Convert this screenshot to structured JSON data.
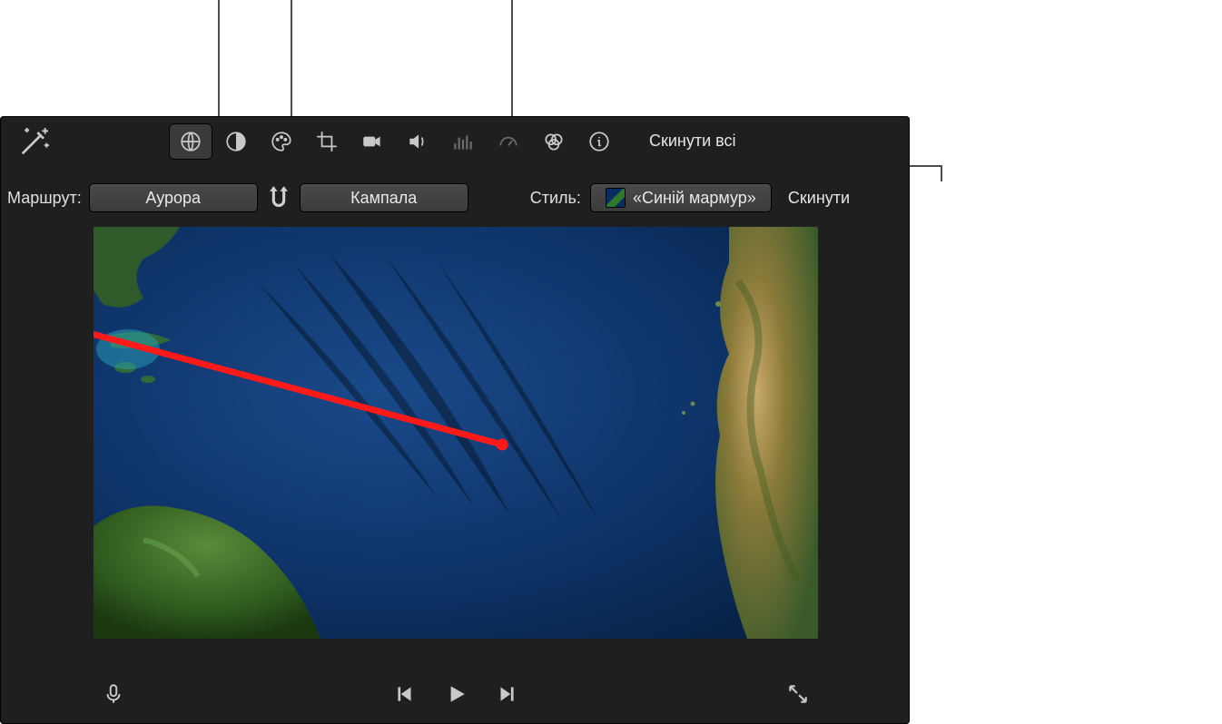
{
  "toolbar": {
    "reset_all_label": "Скинути всі"
  },
  "route": {
    "label": "Маршрут:",
    "start": "Аурора",
    "end": "Кампала"
  },
  "style": {
    "label": "Стиль:",
    "value": "«Синій мармур»",
    "reset_label": "Скинути"
  },
  "icons": {
    "wand": "magic-wand",
    "globe": "globe",
    "contrast": "contrast",
    "palette": "palette",
    "crop": "crop",
    "camera": "video-camera",
    "volume": "volume",
    "eq": "equalizer",
    "speed": "speedometer",
    "filters": "color-filters",
    "info": "info",
    "swap": "swap-route",
    "mic": "microphone",
    "prev": "skip-back",
    "play": "play",
    "next": "skip-forward",
    "fullscreen": "fullscreen"
  }
}
